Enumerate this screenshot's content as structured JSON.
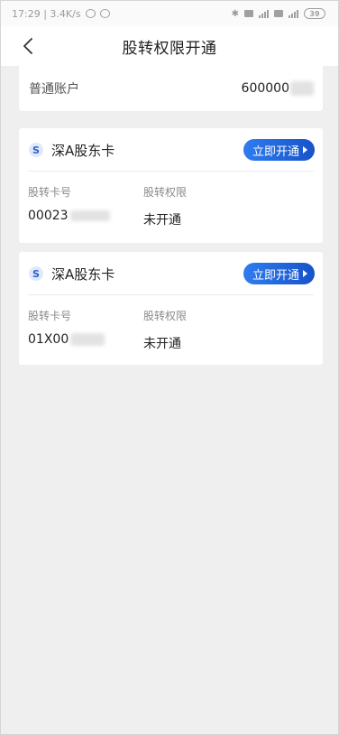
{
  "status_bar": {
    "time_speed": "17:29 | 3.4K/s",
    "battery": "39"
  },
  "header": {
    "title": "股转权限开通"
  },
  "account": {
    "label": "普通账户",
    "value": "600000"
  },
  "cards": [
    {
      "logo": "S",
      "name": "深A股东卡",
      "button_label": "立即开通",
      "card_no_label": "股转卡号",
      "card_no_value": "00023",
      "permission_label": "股转权限",
      "permission_value": "未开通"
    },
    {
      "logo": "S",
      "name": "深A股东卡",
      "button_label": "立即开通",
      "card_no_label": "股转卡号",
      "card_no_value": "01X00",
      "permission_label": "股转权限",
      "permission_value": "未开通"
    }
  ],
  "colors": {
    "accent": "#1f63dc",
    "background": "#efefef"
  }
}
